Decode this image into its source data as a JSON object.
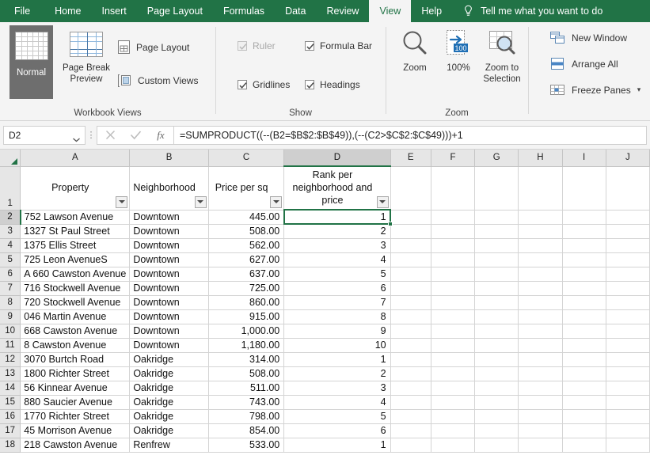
{
  "ribbon_tabs": [
    {
      "label": "File",
      "active": false
    },
    {
      "label": "Home",
      "active": false
    },
    {
      "label": "Insert",
      "active": false
    },
    {
      "label": "Page Layout",
      "active": false
    },
    {
      "label": "Formulas",
      "active": false
    },
    {
      "label": "Data",
      "active": false
    },
    {
      "label": "Review",
      "active": false
    },
    {
      "label": "View",
      "active": true
    },
    {
      "label": "Help",
      "active": false
    }
  ],
  "tellme": {
    "label": "Tell me what you want to do",
    "icon": "lightbulb-icon"
  },
  "groups": {
    "workbook_views": {
      "label": "Workbook Views",
      "normal": "Normal",
      "page_break_preview": "Page Break\nPreview",
      "page_break_preview_l1": "Page Break",
      "page_break_preview_l2": "Preview",
      "page_layout": "Page Layout",
      "custom_views": "Custom Views"
    },
    "show": {
      "label": "Show",
      "ruler": "Ruler",
      "ruler_checked": true,
      "ruler_disabled": true,
      "formula_bar": "Formula Bar",
      "formula_bar_checked": true,
      "gridlines": "Gridlines",
      "gridlines_checked": true,
      "headings": "Headings",
      "headings_checked": true
    },
    "zoom": {
      "label": "Zoom",
      "zoom": "Zoom",
      "hundred": "100%",
      "hundred_badge": "100",
      "zoom_to_selection_l1": "Zoom to",
      "zoom_to_selection_l2": "Selection"
    },
    "window": {
      "new_window": "New Window",
      "arrange_all": "Arrange All",
      "freeze_panes": "Freeze Panes"
    }
  },
  "formula_bar": {
    "name_box": "D2",
    "cancel_icon": "cancel-x-icon",
    "confirm_icon": "confirm-check-icon",
    "fx_label": "fx",
    "formula": "=SUMPRODUCT((--(B2=$B$2:$B$49)),(--(C2>$C$2:$C$49)))+1"
  },
  "sheet": {
    "column_letters": [
      "A",
      "B",
      "C",
      "D",
      "E",
      "F",
      "G",
      "H",
      "I",
      "J"
    ],
    "selected_column": "D",
    "selected_row": 2,
    "selected_cell": "D2",
    "row_numbers": [
      1,
      2,
      3,
      4,
      5,
      6,
      7,
      8,
      9,
      10,
      11,
      12,
      13,
      14,
      15,
      16,
      17,
      18
    ],
    "headers": [
      {
        "text": "Property",
        "filter": true
      },
      {
        "text": "Neighborhood",
        "filter": true
      },
      {
        "text": "Price per sq",
        "filter": true
      },
      {
        "text": "Rank per neighborhood and price",
        "filter": true
      }
    ],
    "rows": [
      {
        "n": 2,
        "property": "752 Lawson Avenue",
        "neighborhood": "Downtown",
        "price": "445.00",
        "rank": "1"
      },
      {
        "n": 3,
        "property": "1327 St Paul Street",
        "neighborhood": "Downtown",
        "price": "508.00",
        "rank": "2"
      },
      {
        "n": 4,
        "property": "1375 Ellis Street",
        "neighborhood": "Downtown",
        "price": "562.00",
        "rank": "3"
      },
      {
        "n": 5,
        "property": "725 Leon AvenueS",
        "neighborhood": "Downtown",
        "price": "627.00",
        "rank": "4"
      },
      {
        "n": 6,
        "property": "A 660 Cawston Avenue",
        "neighborhood": "Downtown",
        "price": "637.00",
        "rank": "5"
      },
      {
        "n": 7,
        "property": "716 Stockwell Avenue",
        "neighborhood": "Downtown",
        "price": "725.00",
        "rank": "6"
      },
      {
        "n": 8,
        "property": "720 Stockwell Avenue",
        "neighborhood": "Downtown",
        "price": "860.00",
        "rank": "7"
      },
      {
        "n": 9,
        "property": "046 Martin Avenue",
        "neighborhood": "Downtown",
        "price": "915.00",
        "rank": "8"
      },
      {
        "n": 10,
        "property": "668 Cawston Avenue",
        "neighborhood": "Downtown",
        "price": "1,000.00",
        "rank": "9"
      },
      {
        "n": 11,
        "property": "8 Cawston Avenue",
        "neighborhood": "Downtown",
        "price": "1,180.00",
        "rank": "10"
      },
      {
        "n": 12,
        "property": "3070 Burtch Road",
        "neighborhood": "Oakridge",
        "price": "314.00",
        "rank": "1"
      },
      {
        "n": 13,
        "property": "1800 Richter Street",
        "neighborhood": "Oakridge",
        "price": "508.00",
        "rank": "2"
      },
      {
        "n": 14,
        "property": "56 Kinnear Avenue",
        "neighborhood": "Oakridge",
        "price": "511.00",
        "rank": "3"
      },
      {
        "n": 15,
        "property": "880 Saucier Avenue",
        "neighborhood": "Oakridge",
        "price": "743.00",
        "rank": "4"
      },
      {
        "n": 16,
        "property": "1770 Richter Street",
        "neighborhood": "Oakridge",
        "price": "798.00",
        "rank": "5"
      },
      {
        "n": 17,
        "property": "45 Morrison Avenue",
        "neighborhood": "Oakridge",
        "price": "854.00",
        "rank": "6"
      },
      {
        "n": 18,
        "property": "218 Cawston Avenue",
        "neighborhood": "Renfrew",
        "price": "533.00",
        "rank": "1"
      }
    ]
  },
  "colors": {
    "brand_green": "#217346",
    "ribbon_bg": "#f4f4f4",
    "header_gray": "#e6e6e6",
    "selected_header_gray": "#cfcfcf",
    "gridline": "#d4d4d4"
  }
}
